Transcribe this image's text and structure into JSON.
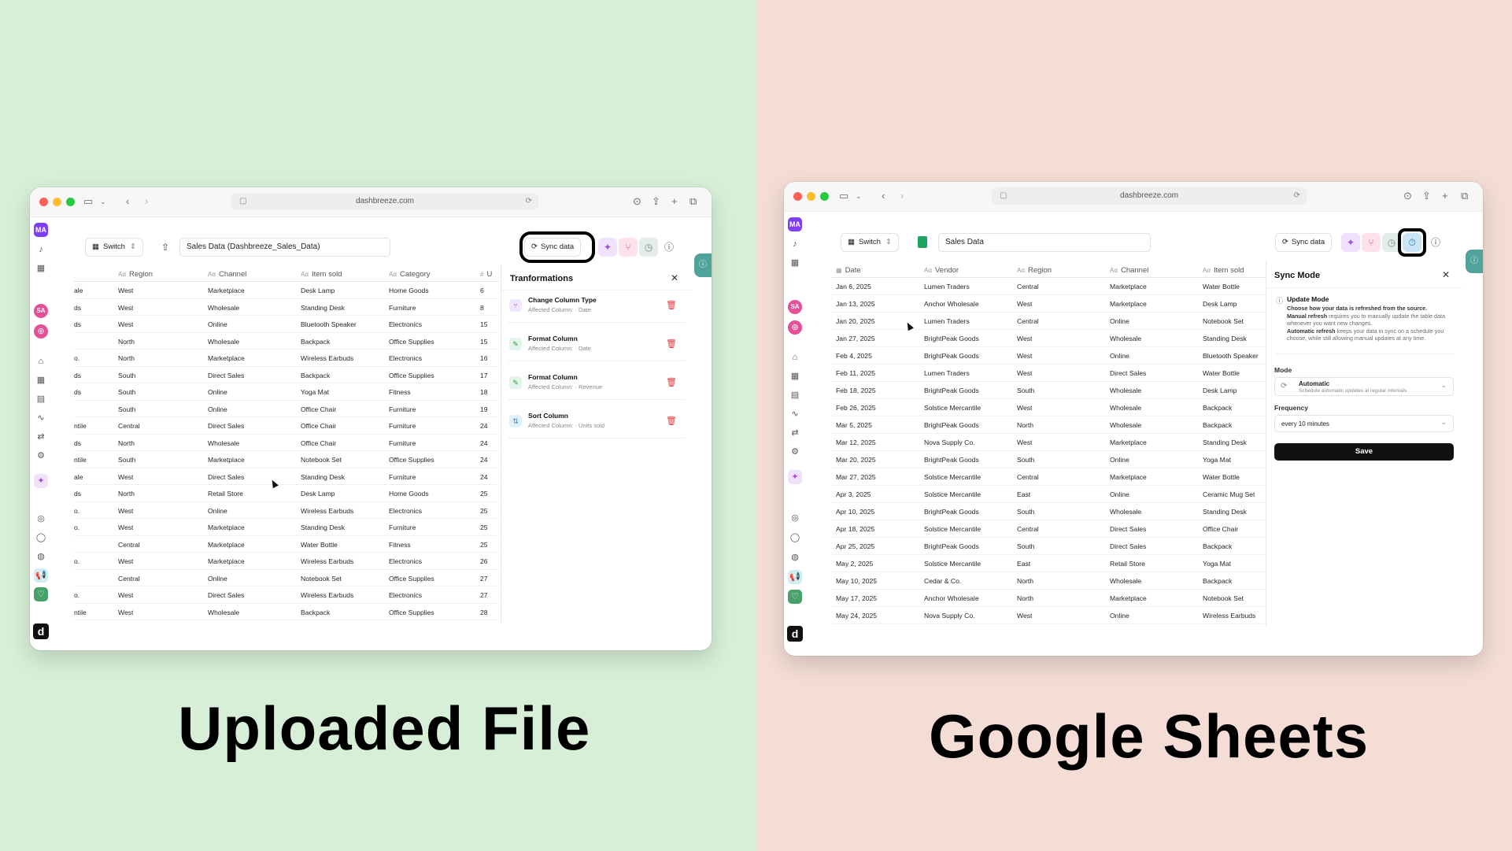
{
  "captions": {
    "left": "Uploaded File",
    "right": "Google Sheets"
  },
  "browser": {
    "url": "dashbreeze.com"
  },
  "sidebar": {
    "avatar": "MA",
    "avatar2": "SA",
    "badge": "8",
    "logo": "d"
  },
  "toolbar": {
    "switch_label": "Switch",
    "sync_label": "Sync data"
  },
  "left_window": {
    "file_name": "Sales Data (Dashbreeze_Sales_Data)",
    "headers": [
      "Region",
      "Channel",
      "Item sold",
      "Category",
      "U"
    ],
    "rows": [
      [
        "ale",
        "West",
        "Marketplace",
        "Desk Lamp",
        "Home Goods",
        "6"
      ],
      [
        "ds",
        "West",
        "Wholesale",
        "Standing Desk",
        "Furniture",
        "8"
      ],
      [
        "ds",
        "West",
        "Online",
        "Bluetooth Speaker",
        "Electronics",
        "15"
      ],
      [
        "",
        "North",
        "Wholesale",
        "Backpack",
        "Office Supplies",
        "15"
      ],
      [
        "o.",
        "North",
        "Marketplace",
        "Wireless Earbuds",
        "Electronics",
        "16"
      ],
      [
        "ds",
        "South",
        "Direct Sales",
        "Backpack",
        "Office Supplies",
        "17"
      ],
      [
        "ds",
        "South",
        "Online",
        "Yoga Mat",
        "Fitness",
        "18"
      ],
      [
        "",
        "South",
        "Online",
        "Office Chair",
        "Furniture",
        "19"
      ],
      [
        "ntile",
        "Central",
        "Direct Sales",
        "Office Chair",
        "Furniture",
        "24"
      ],
      [
        "ds",
        "North",
        "Wholesale",
        "Office Chair",
        "Furniture",
        "24"
      ],
      [
        "ntile",
        "South",
        "Marketplace",
        "Notebook Set",
        "Office Supplies",
        "24"
      ],
      [
        "ale",
        "West",
        "Direct Sales",
        "Standing Desk",
        "Furniture",
        "24"
      ],
      [
        "ds",
        "North",
        "Retail Store",
        "Desk Lamp",
        "Home Goods",
        "25"
      ],
      [
        "o.",
        "West",
        "Online",
        "Wireless Earbuds",
        "Electronics",
        "25"
      ],
      [
        "o.",
        "West",
        "Marketplace",
        "Standing Desk",
        "Furniture",
        "25"
      ],
      [
        "",
        "Central",
        "Marketplace",
        "Water Bottle",
        "Fitness",
        "25"
      ],
      [
        "o.",
        "West",
        "Marketplace",
        "Wireless Earbuds",
        "Electronics",
        "26"
      ],
      [
        "",
        "Central",
        "Online",
        "Notebook Set",
        "Office Supplies",
        "27"
      ],
      [
        "o.",
        "West",
        "Direct Sales",
        "Wireless Earbuds",
        "Electronics",
        "27"
      ],
      [
        "ntile",
        "West",
        "Wholesale",
        "Backpack",
        "Office Supplies",
        "28"
      ]
    ],
    "transformations": {
      "title": "Tranformations",
      "items": [
        {
          "title": "Change Column Type",
          "sub": "Affected Column: · Date"
        },
        {
          "title": "Format Column",
          "sub": "Affected Column: · Date"
        },
        {
          "title": "Format Column",
          "sub": "Affected Column: · Revenue"
        },
        {
          "title": "Sort Column",
          "sub": "Affected Column: · Units sold"
        }
      ]
    }
  },
  "right_window": {
    "file_name": "Sales Data",
    "headers": [
      "Date",
      "Vendor",
      "Region",
      "Channel",
      "Item sold"
    ],
    "rows": [
      [
        "Jan 6, 2025",
        "Lumen Traders",
        "Central",
        "Marketplace",
        "Water Bottle"
      ],
      [
        "Jan 13, 2025",
        "Anchor Wholesale",
        "West",
        "Marketplace",
        "Desk Lamp"
      ],
      [
        "Jan 20, 2025",
        "Lumen Traders",
        "Central",
        "Online",
        "Notebook Set"
      ],
      [
        "Jan 27, 2025",
        "BrightPeak Goods",
        "West",
        "Wholesale",
        "Standing Desk"
      ],
      [
        "Feb 4, 2025",
        "BrightPeak Goods",
        "West",
        "Online",
        "Bluetooth Speaker"
      ],
      [
        "Feb 11, 2025",
        "Lumen Traders",
        "West",
        "Direct Sales",
        "Water Bottle"
      ],
      [
        "Feb 18, 2025",
        "BrightPeak Goods",
        "South",
        "Wholesale",
        "Desk Lamp"
      ],
      [
        "Feb 26, 2025",
        "Solstice Mercantile",
        "West",
        "Wholesale",
        "Backpack"
      ],
      [
        "Mar 5, 2025",
        "BrightPeak Goods",
        "North",
        "Wholesale",
        "Backpack"
      ],
      [
        "Mar 12, 2025",
        "Nova Supply Co.",
        "West",
        "Marketplace",
        "Standing Desk"
      ],
      [
        "Mar 20, 2025",
        "BrightPeak Goods",
        "South",
        "Online",
        "Yoga Mat"
      ],
      [
        "Mar 27, 2025",
        "Solstice Mercantile",
        "Central",
        "Marketplace",
        "Water Bottle"
      ],
      [
        "Apr 3, 2025",
        "Solstice Mercantile",
        "East",
        "Online",
        "Ceramic Mug Set"
      ],
      [
        "Apr 10, 2025",
        "BrightPeak Goods",
        "South",
        "Wholesale",
        "Standing Desk"
      ],
      [
        "Apr 18, 2025",
        "Solstice Mercantile",
        "Central",
        "Direct Sales",
        "Office Chair"
      ],
      [
        "Apr 25, 2025",
        "BrightPeak Goods",
        "South",
        "Direct Sales",
        "Backpack"
      ],
      [
        "May 2, 2025",
        "Solstice Mercantile",
        "East",
        "Retail Store",
        "Yoga Mat"
      ],
      [
        "May 10, 2025",
        "Cedar & Co.",
        "North",
        "Wholesale",
        "Backpack"
      ],
      [
        "May 17, 2025",
        "Anchor Wholesale",
        "North",
        "Marketplace",
        "Notebook Set"
      ],
      [
        "May 24, 2025",
        "Nova Supply Co.",
        "West",
        "Online",
        "Wireless Earbuds"
      ]
    ],
    "sync_mode": {
      "title": "Sync Mode",
      "update_mode_title": "Update Mode",
      "desc1": "Choose how your data is refreshed from the source.",
      "manual_label": "Manual refresh",
      "manual_desc": " requires you to manually update the table data whenever you want new changes.",
      "auto_label": "Automatic refresh",
      "auto_desc": " keeps your data in sync on a schedule you choose, while still allowing manual updates at any time.",
      "mode_label": "Mode",
      "mode_value": "Automatic",
      "mode_sub": "Schedule automatic updates at regular intervals",
      "frequency_label": "Frequency",
      "frequency_value": "every 10 minutes",
      "save_label": "Save"
    }
  },
  "colors": {
    "left_bg": "#d7efd6",
    "right_bg": "#f3ddd5",
    "accent_purple": "#7e3ff2",
    "accent_pink": "#e44f97",
    "danger": "#e0393e"
  }
}
